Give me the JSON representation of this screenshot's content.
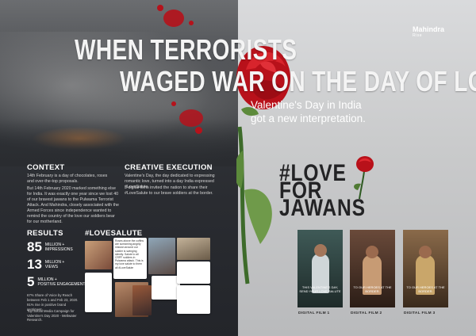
{
  "brand": {
    "name": "Mahindra",
    "tagline": "Rise"
  },
  "headline": {
    "line1": "WHEN TERRORISTS",
    "line2": "WAGED WAR ON THE DAY OF LOVE,"
  },
  "subheadline": "Valentine's Day in India got a new interpretation.",
  "context": {
    "title": "CONTEXT",
    "p1": "14th February is a day of chocolates, roses and over-the-top proposals.",
    "p2": "But 14th February 2020 marked something else for India. It was exactly one year since we lost 40 of our bravest jawans to the Pulwama Terrorist Attack. And Mahindra, closely associated with the Armed Forces since independence wanted to remind the country of the love our soldiers bear for our motherland."
  },
  "creative": {
    "title": "CREATIVE EXECUTION",
    "p1": "Valentine's Day, the day dedicated to expressing romantic love, turned into a day India expressed #LoveSalute.",
    "p2": "3 digital films invited the nation to share their #LoveSalute to our brave soldiers at the border."
  },
  "results": {
    "title": "RESULTS",
    "items": [
      {
        "value": "85",
        "unit": "MILLION +",
        "label": "IMPRESSIONS"
      },
      {
        "value": "13",
        "unit": "MILLION +",
        "label": "VIEWS"
      },
      {
        "value": "5",
        "unit": "MILLION +",
        "label": "POSITIVE ENGAGEMENTS"
      }
    ],
    "note1": "67% Share of Voice by Reach between Feb 1 and Feb 23, 2020.",
    "note2": "91% rise in positive brand sentiment.",
    "note3": "Top Social Media Campaign for Valentine's Day 2020 - Meltwater Research."
  },
  "collage": {
    "hashtag": "#LOVESALUTE",
    "tweet_text": "Roses above the coffins are screaming angrily mission around our soldier is swinging silently. Salute to all CRPF soldiers in Pulwama attack. This is my love salute to them all #LoveSalute"
  },
  "campaign": {
    "logo_line1": "#LOVE",
    "logo_line2": "FOR",
    "logo_line3": "JAWANS"
  },
  "films": [
    {
      "caption": "DIGITAL FILM 1",
      "overlay": "THIS VALENTINE'S DAY, SEND YOUR LOVE SALUTE"
    },
    {
      "caption": "DIGITAL FILM 2",
      "overlay": "TO OUR HEROES AT THE BORDER."
    },
    {
      "caption": "DIGITAL FILM 3",
      "overlay": "TO OUR HEROES AT THE BORDER."
    }
  ],
  "colors": {
    "blood": "#b5121b",
    "rose": "#c8141e",
    "leaf": "#4f7a33",
    "dark": "#2a2c31"
  }
}
